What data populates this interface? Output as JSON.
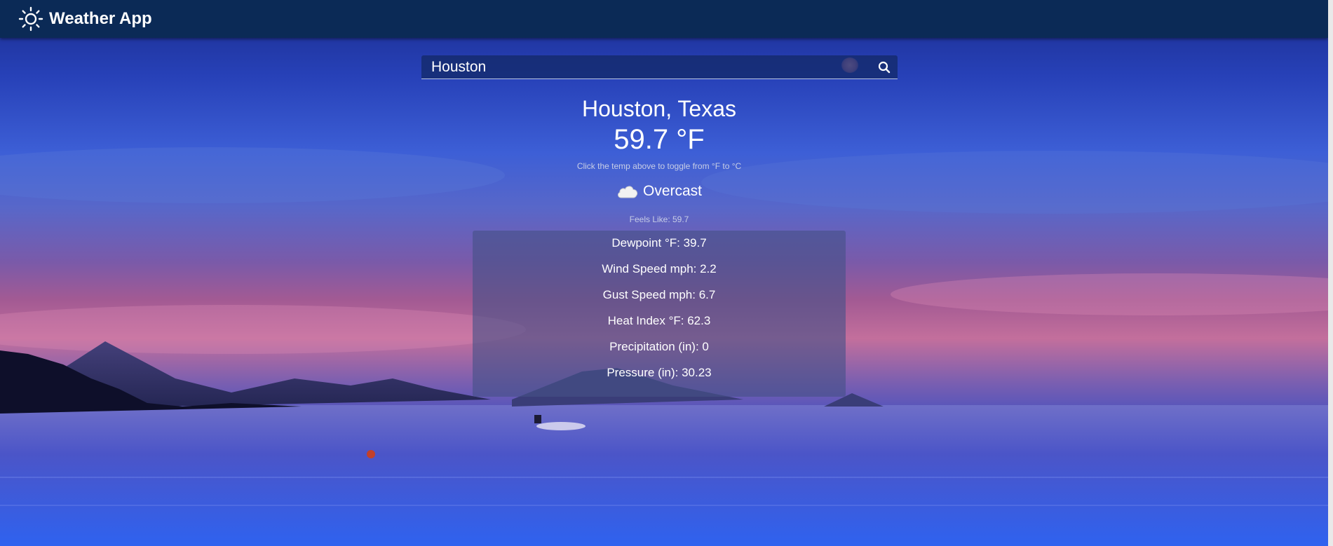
{
  "header": {
    "app_title": "Weather App",
    "logo_icon": "sun-icon"
  },
  "search": {
    "value": "Houston",
    "placeholder": "Houston",
    "button_icon": "search-icon"
  },
  "weather": {
    "location": "Houston, Texas",
    "temperature": "59.7 °F",
    "toggle_hint": "Click the temp above to toggle from °F to °C",
    "condition_icon": "cloud-icon",
    "condition": "Overcast",
    "feels_like": "Feels Like: 59.7"
  },
  "details": [
    {
      "label": "Dewpoint °F: 39.7"
    },
    {
      "label": "Wind Speed mph: 2.2"
    },
    {
      "label": "Gust Speed mph: 6.7"
    },
    {
      "label": "Heat Index °F: 62.3"
    },
    {
      "label": "Precipitation (in): 0"
    },
    {
      "label": "Pressure (in): 30.23"
    }
  ],
  "colors": {
    "navbar": "#0b2a56",
    "text": "#ffffff",
    "muted_text": "#c7cde6"
  }
}
